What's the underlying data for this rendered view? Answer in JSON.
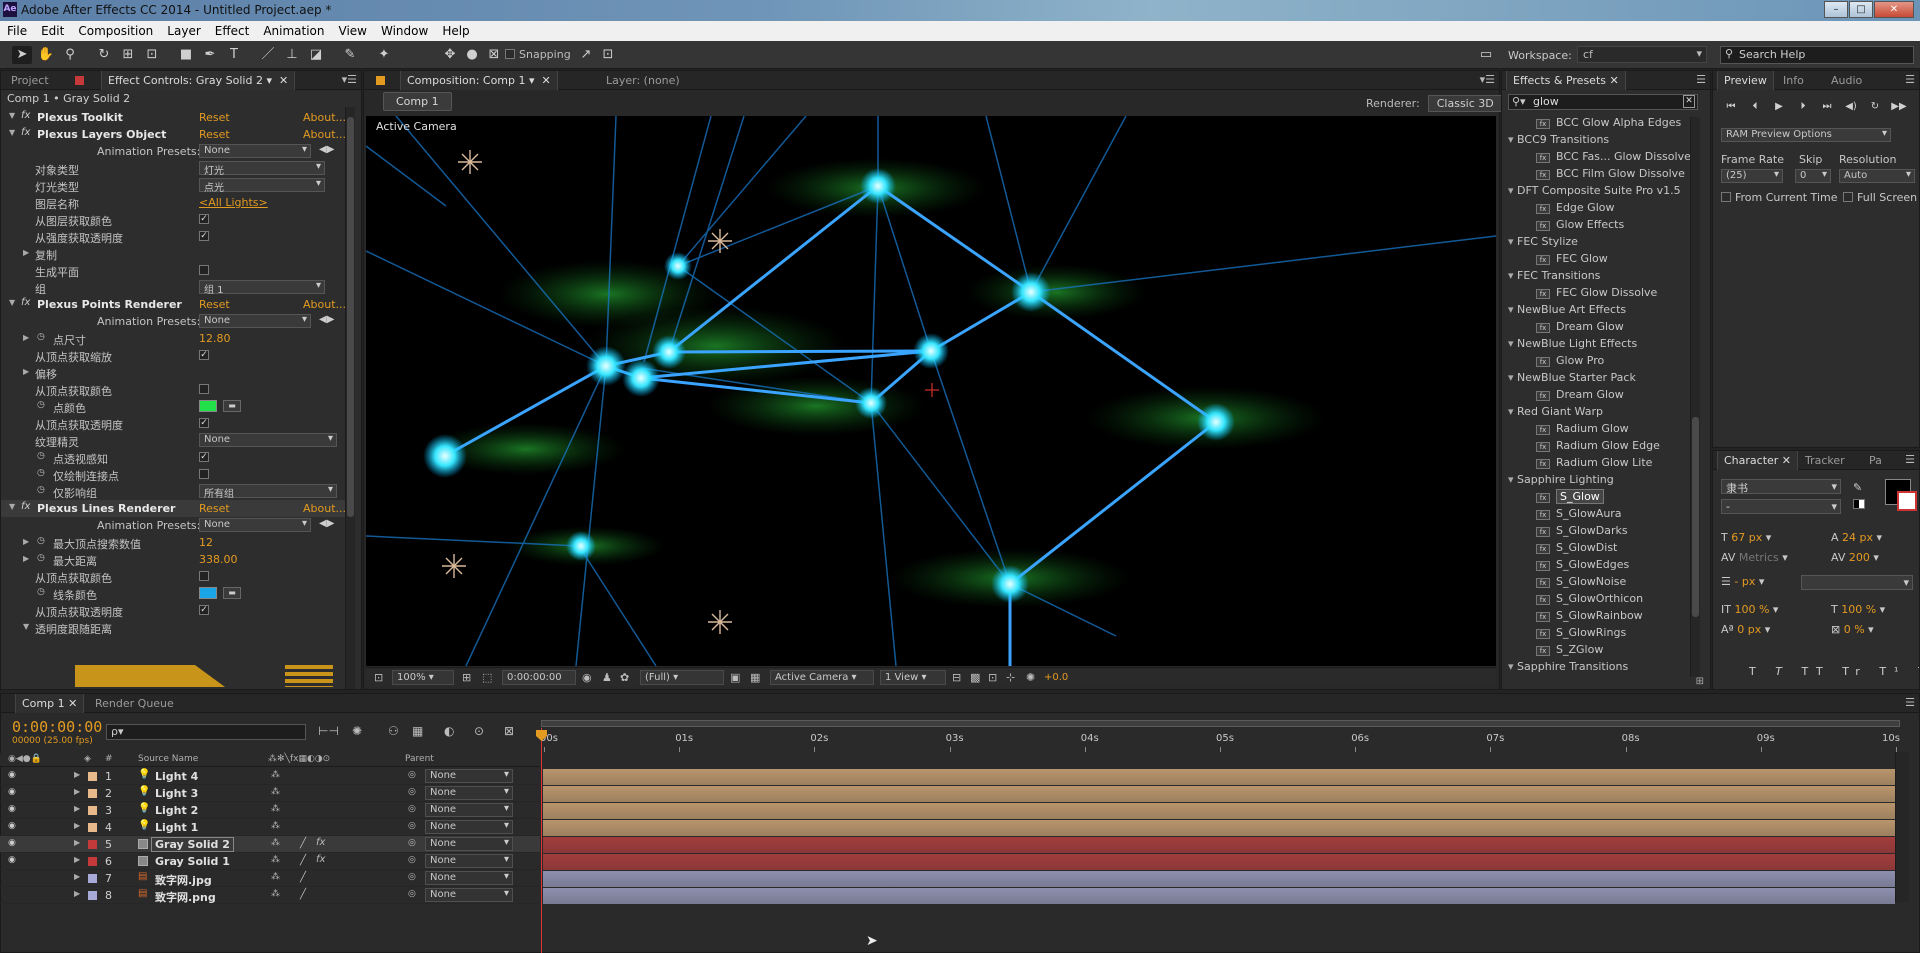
{
  "window": {
    "app_logo": "Ae",
    "title": "Adobe After Effects CC 2014 - Untitled Project.aep *",
    "minimize": "–",
    "maximize": "□",
    "close": "✕"
  },
  "menu": [
    "File",
    "Edit",
    "Composition",
    "Layer",
    "Effect",
    "Animation",
    "View",
    "Window",
    "Help"
  ],
  "toolbar": {
    "snapping_label": "Snapping",
    "workspace_label": "Workspace:",
    "workspace_value": "cf",
    "search_help_placeholder": "Search Help"
  },
  "left_panel": {
    "tabs": [
      "Project",
      "Effect Controls: Gray Solid 2"
    ],
    "header": "Comp 1 • Gray Solid 2",
    "rows": [
      {
        "label": "Plexus Toolkit",
        "type": "group",
        "reset": "Reset",
        "about": "About..."
      },
      {
        "label": "Plexus Layers Object",
        "type": "group",
        "reset": "Reset",
        "about": "About..."
      },
      {
        "label": "Animation Presets:",
        "type": "preset",
        "value": "None"
      },
      {
        "label": "对象类型",
        "type": "dropdown",
        "value": "灯光"
      },
      {
        "label": "灯光类型",
        "type": "dropdown",
        "value": "点光"
      },
      {
        "label": "图层名称",
        "type": "link",
        "value": "<All Lights>"
      },
      {
        "label": "从图层获取颜色",
        "type": "check",
        "value": "✓"
      },
      {
        "label": "从强度获取透明度",
        "type": "check",
        "value": "✓"
      },
      {
        "label": "复制",
        "type": "twirl"
      },
      {
        "label": "生成平面",
        "type": "check",
        "value": ""
      },
      {
        "label": "组",
        "type": "dropdown",
        "value": "组 1"
      },
      {
        "label": "Plexus Points Renderer",
        "type": "group",
        "reset": "Reset",
        "about": "About..."
      },
      {
        "label": "Animation Presets:",
        "type": "preset",
        "value": "None"
      },
      {
        "label": "点尺寸",
        "type": "number",
        "value": "12.80"
      },
      {
        "label": "从顶点获取缩放",
        "type": "check",
        "value": "✓"
      },
      {
        "label": "偏移",
        "type": "twirl"
      },
      {
        "label": "从顶点获取颜色",
        "type": "check",
        "value": ""
      },
      {
        "label": "点颜色",
        "type": "color",
        "value": "#22e04a"
      },
      {
        "label": "从顶点获取透明度",
        "type": "check",
        "value": "✓"
      },
      {
        "label": "纹理精灵",
        "type": "dropdown",
        "value": "None"
      },
      {
        "label": "点透视感知",
        "type": "check",
        "value": "✓"
      },
      {
        "label": "仅绘制连接点",
        "type": "check",
        "value": ""
      },
      {
        "label": "仅影响组",
        "type": "dropdown",
        "value": "所有组"
      },
      {
        "label": "Plexus Lines Renderer",
        "type": "group",
        "reset": "Reset",
        "about": "About..."
      },
      {
        "label": "Animation Presets:",
        "type": "preset",
        "value": "None"
      },
      {
        "label": "最大顶点搜索数值",
        "type": "number",
        "value": "12"
      },
      {
        "label": "最大距离",
        "type": "number",
        "value": "338.00"
      },
      {
        "label": "从顶点获取颜色",
        "type": "check",
        "value": ""
      },
      {
        "label": "线条颜色",
        "type": "color",
        "value": "#1aa6e6"
      },
      {
        "label": "从顶点获取透明度",
        "type": "check",
        "value": "✓"
      },
      {
        "label": "透明度跟随距离",
        "type": "twirl"
      }
    ]
  },
  "comp_panel": {
    "tab": "Composition: Comp 1",
    "layer_tab": "Layer: (none)",
    "comp_button": "Comp 1",
    "renderer_label": "Renderer:",
    "renderer_value": "Classic 3D",
    "camera_label": "Active Camera",
    "bottom": {
      "zoom": "100%",
      "timecode": "0:00:00:00",
      "resolution": "(Full)",
      "camera": "Active Camera",
      "views": "1 View",
      "exposure": "+0.0"
    }
  },
  "effects_presets": {
    "tab": "Effects & Presets",
    "search_value": "glow",
    "items": [
      {
        "type": "fx",
        "label": "BCC Glow Alpha Edges"
      },
      {
        "type": "cat",
        "label": "BCC9 Transitions"
      },
      {
        "type": "fx",
        "label": "BCC Fas... Glow Dissolve"
      },
      {
        "type": "fx",
        "label": "BCC Film Glow Dissolve"
      },
      {
        "type": "cat",
        "label": "DFT Composite Suite Pro v1.5"
      },
      {
        "type": "fx",
        "label": "Edge Glow"
      },
      {
        "type": "fx",
        "label": "Glow Effects"
      },
      {
        "type": "cat",
        "label": "FEC Stylize"
      },
      {
        "type": "fx",
        "label": "FEC Glow"
      },
      {
        "type": "cat",
        "label": "FEC Transitions"
      },
      {
        "type": "fx",
        "label": "FEC Glow Dissolve"
      },
      {
        "type": "cat",
        "label": "NewBlue Art Effects"
      },
      {
        "type": "fx",
        "label": "Dream Glow"
      },
      {
        "type": "cat",
        "label": "NewBlue Light Effects"
      },
      {
        "type": "fx",
        "label": "Glow Pro"
      },
      {
        "type": "cat",
        "label": "NewBlue Starter Pack"
      },
      {
        "type": "fx",
        "label": "Dream Glow"
      },
      {
        "type": "cat",
        "label": "Red Giant Warp"
      },
      {
        "type": "fx",
        "label": "Radium Glow"
      },
      {
        "type": "fx",
        "label": "Radium Glow Edge"
      },
      {
        "type": "fx",
        "label": "Radium Glow Lite"
      },
      {
        "type": "cat",
        "label": "Sapphire Lighting"
      },
      {
        "type": "fx",
        "label": "S_Glow",
        "selected": true
      },
      {
        "type": "fx",
        "label": "S_GlowAura"
      },
      {
        "type": "fx",
        "label": "S_GlowDarks"
      },
      {
        "type": "fx",
        "label": "S_GlowDist"
      },
      {
        "type": "fx",
        "label": "S_GlowEdges"
      },
      {
        "type": "fx",
        "label": "S_GlowNoise"
      },
      {
        "type": "fx",
        "label": "S_GlowOrthicon"
      },
      {
        "type": "fx",
        "label": "S_GlowRainbow"
      },
      {
        "type": "fx",
        "label": "S_GlowRings"
      },
      {
        "type": "fx",
        "label": "S_ZGlow"
      },
      {
        "type": "cat",
        "label": "Sapphire Transitions"
      }
    ]
  },
  "preview": {
    "tabs": [
      "Preview",
      "Info",
      "Audio"
    ],
    "ram_options": "RAM Preview Options",
    "frame_rate_label": "Frame Rate",
    "skip_label": "Skip",
    "resolution_label": "Resolution",
    "frame_rate_value": "(25)",
    "skip_value": "0",
    "resolution_value": "Auto",
    "from_current": "From Current Time",
    "full_screen": "Full Screen"
  },
  "character": {
    "tabs": [
      "Character",
      "Tracker",
      "Pa"
    ],
    "font": "隶书",
    "style": "-",
    "size": "67 px",
    "leading": "24 px",
    "kerning": "Metrics",
    "tracking": "200",
    "stroke": "- px",
    "vscale": "100 %",
    "hscale": "100 %",
    "baseline": "0 px",
    "tsume": "0 %",
    "fill_color": "#000000"
  },
  "timeline": {
    "tabs": [
      "Comp 1",
      "Render Queue"
    ],
    "time": "0:00:00:00",
    "fps": "00000 (25.00 fps)",
    "search_placeholder": "ρ▾",
    "col_source_name": "Source Name",
    "col_num": "#",
    "col_parent": "Parent",
    "ruler": [
      "00s",
      "01s",
      "02s",
      "03s",
      "04s",
      "05s",
      "06s",
      "07s",
      "08s",
      "09s",
      "10s"
    ],
    "layers": [
      {
        "num": "1",
        "name": "Light 4",
        "kind": "light",
        "color": "#e8b98a",
        "parent": "None",
        "bar": "#b9956c"
      },
      {
        "num": "2",
        "name": "Light 3",
        "kind": "light",
        "color": "#e8b98a",
        "parent": "None",
        "bar": "#b9956c"
      },
      {
        "num": "3",
        "name": "Light 2",
        "kind": "light",
        "color": "#e8b98a",
        "parent": "None",
        "bar": "#b9956c"
      },
      {
        "num": "4",
        "name": "Light 1",
        "kind": "light",
        "color": "#e8b98a",
        "parent": "None",
        "bar": "#b9956c"
      },
      {
        "num": "5",
        "name": "Gray Solid 2",
        "kind": "solid",
        "color": "#c43a3a",
        "parent": "None",
        "bar": "#a33c3c",
        "selected": true
      },
      {
        "num": "6",
        "name": "Gray Solid 1",
        "kind": "solid",
        "color": "#c43a3a",
        "parent": "None",
        "bar": "#a33c3c"
      },
      {
        "num": "7",
        "name": "致字网.jpg",
        "kind": "image",
        "color": "#a7a9d6",
        "parent": "None",
        "bar": "#8d8fae"
      },
      {
        "num": "8",
        "name": "致字网.png",
        "kind": "image",
        "color": "#a7a9d6",
        "parent": "None",
        "bar": "#8d8fae"
      }
    ]
  }
}
